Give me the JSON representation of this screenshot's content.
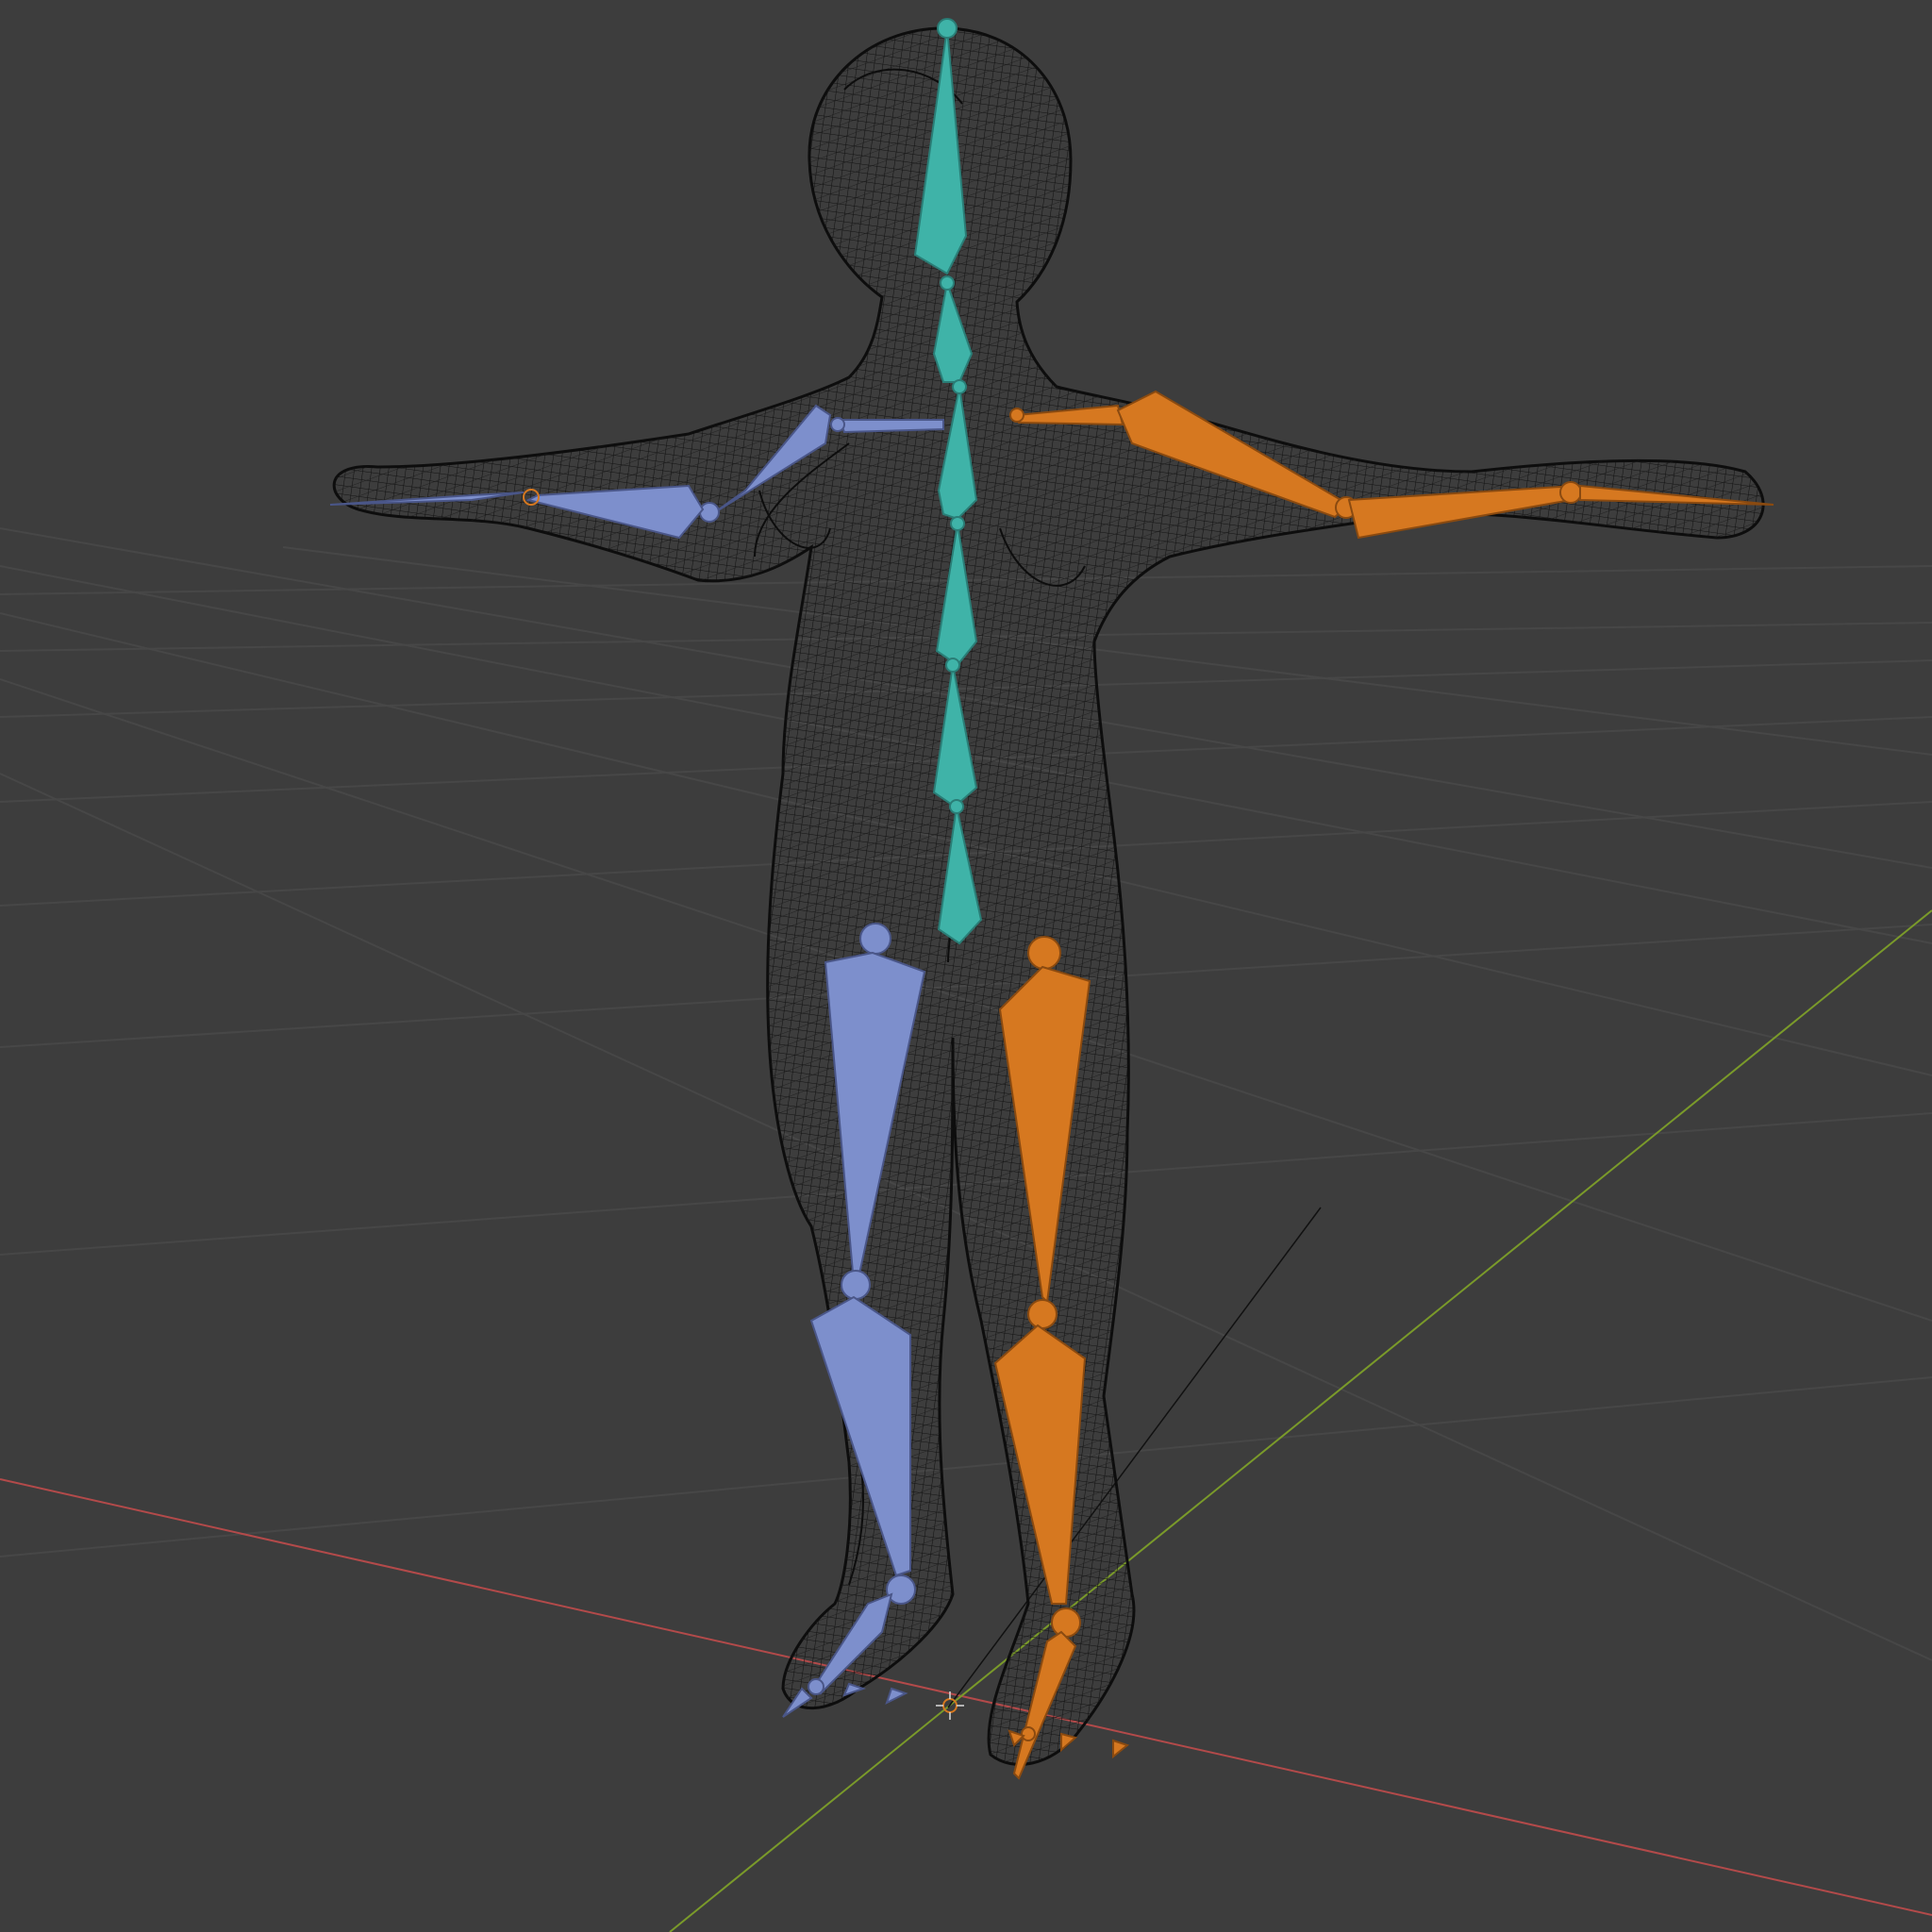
{
  "viewport": {
    "background": "#3d3d3d",
    "grid_color": "#474747",
    "x_axis_color": "#b34a4a",
    "y_axis_color": "#7a9a2a"
  },
  "armature": {
    "spine_color": "#3fb3a8",
    "left_side_color": "#7d8fcc",
    "right_side_color": "#d67820",
    "bones": [
      "head",
      "neck",
      "spine",
      "upper-arm-left",
      "forearm-left",
      "hand-left",
      "upper-arm-right",
      "forearm-right",
      "hand-right",
      "thigh-left",
      "shin-left",
      "foot-left",
      "thigh-right",
      "shin-right",
      "foot-right"
    ]
  },
  "mesh": {
    "display": "wireframe",
    "wire_color": "#121212"
  },
  "icons": {
    "origin": "3d-cursor-icon"
  }
}
